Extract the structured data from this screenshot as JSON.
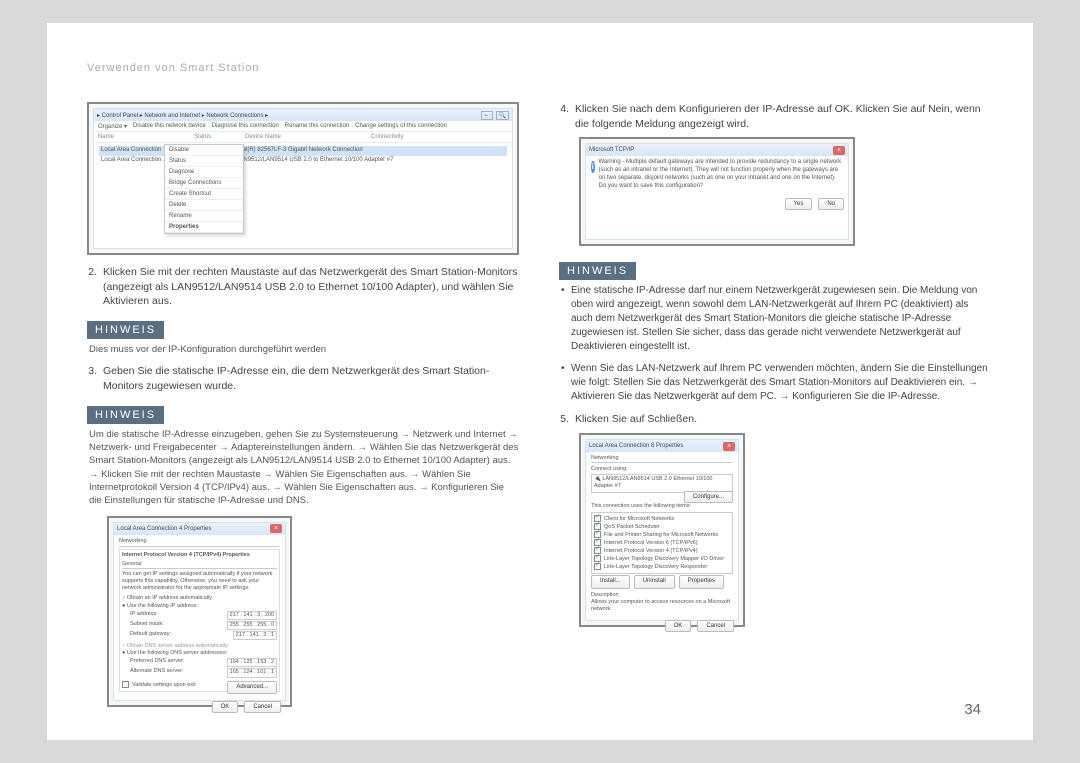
{
  "header": "Verwenden von Smart Station",
  "page_number": "34",
  "hinweis_label": "HINWEIS",
  "left": {
    "step2": {
      "num": "2.",
      "text": "Klicken Sie mit der rechten Maustaste auf das Netzwerkgerät des Smart Station-Monitors (angezeigt als LAN9512/LAN9514 USB 2.0 to Ethernet 10/100 Adapter), und wählen Sie Aktivieren aus."
    },
    "note1": "Dies muss vor der IP-Konfiguration durchgeführt werden",
    "step3": {
      "num": "3.",
      "text": "Geben Sie die statische IP-Adresse ein, die dem Netzwerkgerät des Smart Station-Monitors zugewiesen wurde."
    },
    "note2": "Um die statische IP-Adresse einzugeben, gehen Sie zu Systemsteuerung → Netzwerk und Internet → Netzwerk- und Freigabecenter → Adaptereinstellungen ändern. → Wählen Sie das Netzwerkgerät des Smart Station-Monitors (angezeigt als LAN9512/LAN9514 USB 2.0 to Ethernet 10/100 Adapter) aus. → Klicken Sie mit der rechten Maustaste → Wählen Sie Eigenschaften aus. → Wählen Sie Internetprotokoll Version 4 (TCP/IPv4) aus. → Wählen Sie Eigenschaften aus. → Konfigurieren Sie die Einstellungen für statische IP-Adresse und DNS."
  },
  "right": {
    "step4": {
      "num": "4.",
      "text": "Klicken Sie nach dem Konfigurieren der IP-Adresse auf OK. Klicken Sie auf Nein, wenn die folgende Meldung angezeigt wird."
    },
    "bullet1": "Eine statische IP-Adresse darf nur einem Netzwerkgerät zugewiesen sein. Die Meldung von oben wird angezeigt, wenn sowohl dem LAN-Netzwerkgerät auf Ihrem PC (deaktiviert) als auch dem Netzwerkgerät des Smart Station-Monitors die gleiche statische IP-Adresse zugewiesen ist. Stellen Sie sicher, dass das gerade nicht verwendete Netzwerkgerät auf Deaktivieren eingestellt ist.",
    "bullet2": "Wenn Sie das LAN-Netzwerk auf Ihrem PC verwenden möchten, ändern Sie die Einstellungen wie folgt: Stellen Sie das Netzwerkgerät des Smart Station-Monitors auf Deaktivieren ein. → Aktivieren Sie das Netzwerkgerät auf dem PC. → Konfigurieren Sie die IP-Adresse.",
    "step5": {
      "num": "5.",
      "text": "Klicken Sie auf Schließen."
    }
  },
  "figA": {
    "crumb": "▸ Control Panel ▸ Network and Internet ▸ Network Connections ▸",
    "toolbar": [
      "Organize ▾",
      "Disable this network device",
      "Diagnose this connection",
      "Rename this connection",
      "Change settings of this connection"
    ],
    "cols": [
      "Name",
      "Status",
      "Device Name",
      "Connectivity"
    ],
    "row1": "Local Area Connection",
    "row1_dev": "Intel(R) 82567LF-3 Gigabit Network Connection",
    "row2": "Local Area Connection ...",
    "row2_dev": "LAN9512/LAN9514 USB 2.0 to Ethernet 10/100 Adapter #7",
    "menu": [
      "Disable",
      "Status",
      "Diagnose",
      "Bridge Connections",
      "Create Shortcut",
      "Delete",
      "Rename",
      "Properties"
    ]
  },
  "figB": {
    "title": "Local Area Connection 4 Properties",
    "tab": "Networking",
    "line_top": "Internet Protocol Version 4 (TCP/IPv4) Properties",
    "general": "General",
    "desc": "You can get IP settings assigned automatically if your network supports this capability. Otherwise, you need to ask your network administrator for the appropriate IP settings.",
    "opt_auto": "Obtain an IP address automatically",
    "opt_manual": "Use the following IP address:",
    "ip_label": "IP address:",
    "ip_val": "217 . 141 .  3 . 200",
    "mask_label": "Subnet mask:",
    "mask_val": "255 . 255 . 255 .  0",
    "gw_label": "Default gateway:",
    "gw_val": "217 . 141 .  3 .  1",
    "dns_auto": "Obtain DNS server address automatically",
    "dns_manual": "Use the following DNS server addresses:",
    "dns1_label": "Preferred DNS server:",
    "dns1_val": "164 . 125 . 153 .  2",
    "dns2_label": "Alternate DNS server:",
    "dns2_val": "165 . 124 . 101 .  1",
    "validate": "Validate settings upon exit",
    "adv": "Advanced...",
    "ok": "OK",
    "cancel": "Cancel"
  },
  "figC": {
    "title": "Microsoft TCP/IP",
    "msg": "Warning - Multiple default gateways are intended to provide redundancy to a single network (such as an intranet or the Internet). They will not function properly when the gateways are on two separate, disjoint networks (such as one on your intranet and one on the Internet). Do you want to save this configuration?",
    "yes": "Yes",
    "no": "No"
  },
  "figD": {
    "title": "Local Area Connection 8 Properties",
    "tab": "Networking",
    "connect_using": "Connect using:",
    "adapter": "LAN9512/LAN9514 USB 2.0 Ethernet 10/100 Adapter #7",
    "configure": "Configure...",
    "uses": "This connection uses the following items:",
    "items": [
      "Client for Microsoft Networks",
      "QoS Packet Scheduler",
      "File and Printer Sharing for Microsoft Networks",
      "Internet Protocol Version 6 (TCP/IPv6)",
      "Internet Protocol Version 4 (TCP/IPv4)",
      "Link-Layer Topology Discovery Mapper I/O Driver",
      "Link-Layer Topology Discovery Responder"
    ],
    "install": "Install...",
    "uninstall": "Uninstall",
    "properties": "Properties",
    "desc_label": "Description",
    "desc": "Allows your computer to access resources on a Microsoft network.",
    "ok": "OK",
    "cancel": "Cancel"
  }
}
